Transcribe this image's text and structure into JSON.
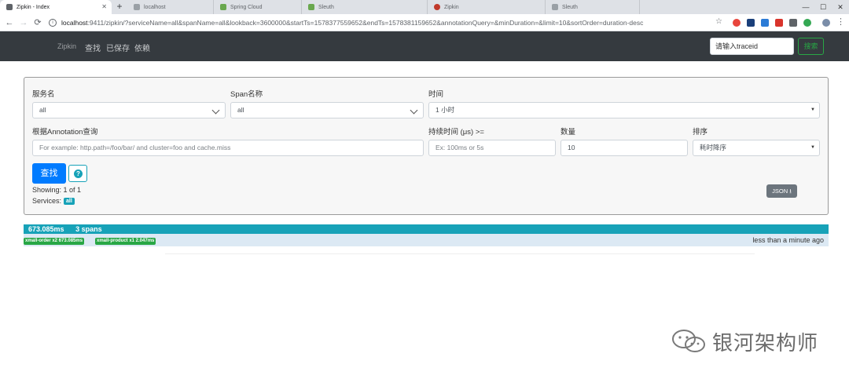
{
  "browser": {
    "tabs": [
      {
        "title": "Zipkin - Index",
        "active": true
      },
      {
        "title": "localhost",
        "active": false
      },
      {
        "title": "Spring Cloud",
        "active": false
      },
      {
        "title": "Sleuth",
        "active": false
      },
      {
        "title": "Zipkin",
        "active": false
      },
      {
        "title": "Sleuth",
        "active": false
      }
    ],
    "new_tab": "+",
    "url_host": "localhost",
    "url_rest": ":9411/zipkin/?serviceName=all&spanName=all&lookback=3600000&startTs=1578377559652&endTs=1578381159652&annotationQuery=&minDuration=&limit=10&sortOrder=duration-desc",
    "window_controls": {
      "minimize": "—",
      "maximize": "☐",
      "close": "✕"
    }
  },
  "navbar": {
    "brand": "Zipkin",
    "links": [
      "查找",
      "已保存",
      "依赖"
    ],
    "trace_placeholder": "请输入traceid",
    "search_label": "搜索"
  },
  "form": {
    "service_label": "服务名",
    "service_value": "all",
    "span_label": "Span名称",
    "span_value": "all",
    "time_label": "时间",
    "time_value": "1 小时",
    "annotation_label": "根据Annotation查询",
    "annotation_placeholder": "For example: http.path=/foo/bar/ and cluster=foo and cache.miss",
    "duration_label": "持续时间 (μs) >=",
    "duration_placeholder": "Ex: 100ms or 5s",
    "limit_label": "数量",
    "limit_value": "10",
    "sort_label": "排序",
    "sort_value": "耗时降序",
    "find_label": "查找",
    "help_label": "?",
    "showing": "Showing: 1 of 1",
    "services_label": "Services:",
    "services_badge": "all",
    "json_label": "JSON"
  },
  "result": {
    "duration": "673.085ms",
    "spans": "3 spans",
    "badges": [
      "xmall-order x2 673.085ms",
      "xmall-product x1 2.047ms"
    ],
    "time_ago": "less than a minute ago"
  },
  "watermark": {
    "text": "银河架构师"
  },
  "colors": {
    "navbar_bg": "#353a3f",
    "primary": "#007bff",
    "info": "#17a2b8",
    "success": "#28a745",
    "secondary": "#6c757d"
  }
}
